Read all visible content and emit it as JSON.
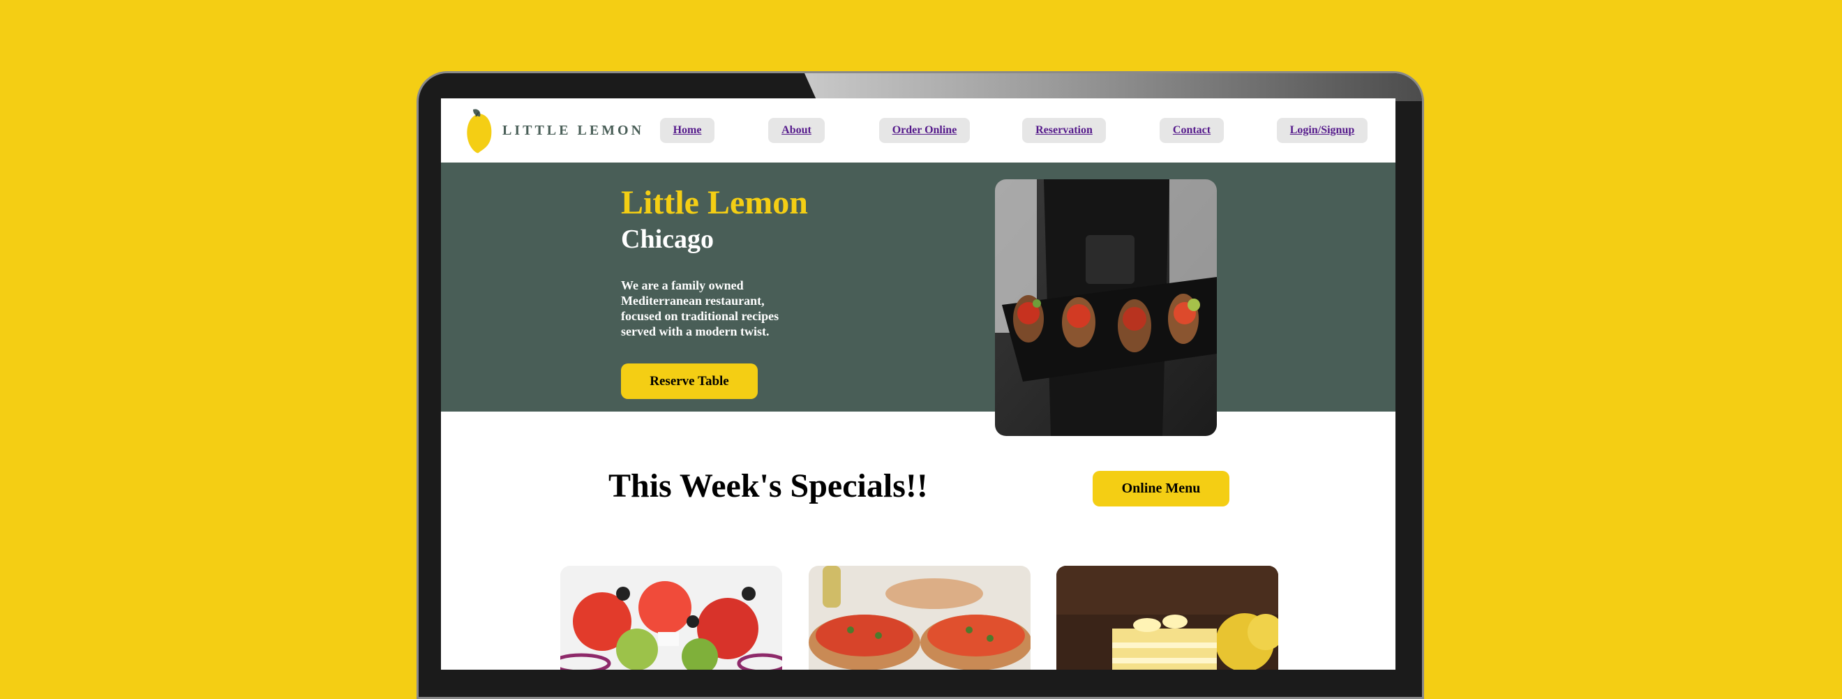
{
  "brand": {
    "name": "LITTLE LEMON"
  },
  "nav": {
    "items": [
      {
        "label": "Home"
      },
      {
        "label": "About"
      },
      {
        "label": "Order Online"
      },
      {
        "label": "Reservation"
      },
      {
        "label": "Contact"
      },
      {
        "label": "Login/Signup"
      }
    ]
  },
  "hero": {
    "title": "Little Lemon",
    "subtitle": "Chicago",
    "description": "We are a family owned Mediterranean restaurant, focused on traditional recipes served with a modern twist.",
    "cta_label": "Reserve Table",
    "image_icon": "chef-holding-bruschetta-platter-photo"
  },
  "specials": {
    "title": "This Week's Specials!!",
    "menu_button_label": "Online Menu",
    "cards": [
      {
        "image_icon": "greek-salad-photo"
      },
      {
        "image_icon": "bruschetta-photo"
      },
      {
        "image_icon": "lemon-dessert-photo"
      }
    ]
  },
  "colors": {
    "background": "#F4CE14",
    "primary_green": "#495E57",
    "primary_yellow": "#F4CE14",
    "nav_button_bg": "#E6E6E6",
    "link": "#551A8B"
  }
}
